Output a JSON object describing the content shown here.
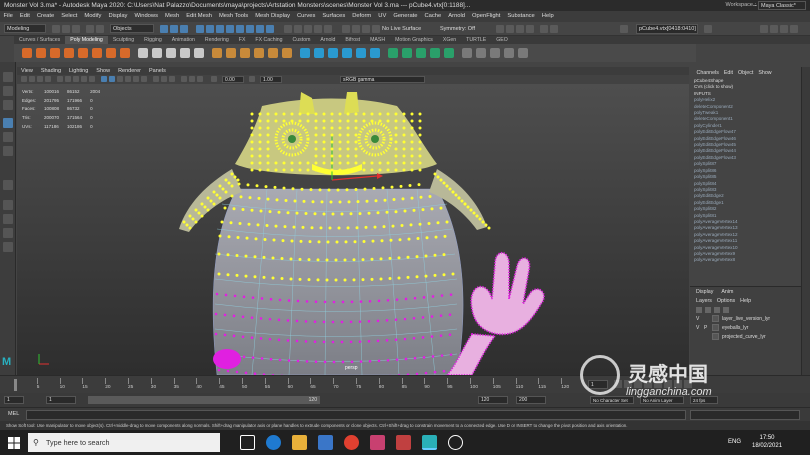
{
  "window": {
    "title": "Monster Vol 3.ma* - Autodesk Maya 2020: C:\\Users\\Nat Palazzo\\Documents\\maya\\projects\\Artstation Monsters\\scenes\\Monster Vol 3.ma   ---   pCube4.vtx[0:1188]...",
    "minimize": "–",
    "maximize": "□",
    "close": "✕"
  },
  "menubar": {
    "items": [
      "File",
      "Edit",
      "Create",
      "Select",
      "Modify",
      "Display",
      "Windows",
      "Mesh",
      "Edit Mesh",
      "Mesh Tools",
      "Mesh Display",
      "Curves",
      "Surfaces",
      "Deform",
      "UV",
      "Generate",
      "Cache",
      "Arnold",
      "OpenFlight",
      "Substance",
      "Help"
    ],
    "workspace_label": "Workspace :",
    "workspace_value": "Maya Classic*"
  },
  "statusline": {
    "mode": "Modeling",
    "objects": "Objects",
    "live_surface": "No Live Surface",
    "symmetry": "Symmetry: Off",
    "name_field": "pCube4.vtx[0418:0410]"
  },
  "shelf": {
    "tabs": [
      "Curves / Surfaces",
      "Poly Modeling",
      "Sculpting",
      "Rigging",
      "Animation",
      "Rendering",
      "FX",
      "FX Caching",
      "Custom",
      "Arnold",
      "Bifrost",
      "MASH",
      "Motion Graphics",
      "XGen",
      "TURTLE",
      "GEO"
    ],
    "active_tab": "Poly Modeling"
  },
  "viewport": {
    "menu": [
      "View",
      "Shading",
      "Lighting",
      "Show",
      "Renderer",
      "Panels"
    ],
    "field_a": "0.00",
    "field_b": "1.00",
    "color_space": "sRGB gamma",
    "camera_label": "persp",
    "hud": [
      {
        "label": "Verts:",
        "a": "100016",
        "b": "86152",
        "c": "2004"
      },
      {
        "label": "Edges:",
        "a": "201795",
        "b": "171966",
        "c": "0"
      },
      {
        "label": "Faces:",
        "a": "100808",
        "b": "86732",
        "c": "0"
      },
      {
        "label": "Tris:",
        "a": "200070",
        "b": "171564",
        "c": "0"
      },
      {
        "label": "UVs:",
        "a": "117186",
        "b": "102186",
        "c": "0"
      }
    ]
  },
  "channel_box": {
    "menu": [
      "Channels",
      "Edit",
      "Object",
      "Show"
    ],
    "object": "pCube4Shape",
    "cvs": "CVs (click to show)",
    "inputs_label": "INPUTS",
    "inputs": [
      "polyHelix2",
      "deleteComponent2",
      "polyTweak1",
      "deleteComponent1",
      "polyCylinder1",
      "polyEditEdgeFlow47",
      "polyEditEdgeFlow46",
      "polyEditEdgeFlow45",
      "polyEditEdgeFlow44",
      "polyEditEdgeFlow43",
      "polySplit87",
      "polySplit86",
      "polySplit85",
      "polySplit84",
      "polySplit83",
      "polyEditEdge2",
      "polyEditEdge1",
      "polySplit82",
      "polySplit81",
      "polyAverageVertex14",
      "polyAverageVertex13",
      "polyAverageVertex12",
      "polyAverageVertex11",
      "polyAverageVertex10",
      "polyAverageVertex9",
      "polyAverageVertex8"
    ]
  },
  "layer_editor": {
    "tabs": [
      "Display",
      "Anim"
    ],
    "menu": [
      "Layers",
      "Options",
      "Help"
    ],
    "layers": [
      {
        "v": "V",
        "p": "",
        "name": "layer_live_version_lyr"
      },
      {
        "v": "V",
        "p": "P",
        "name": "eyeballs_lyr"
      },
      {
        "v": "",
        "p": "",
        "name": "projected_curve_lyr"
      }
    ]
  },
  "timeslider": {
    "ticks": [
      "5",
      "10",
      "15",
      "20",
      "25",
      "30",
      "35",
      "40",
      "45",
      "50",
      "55",
      "60",
      "65",
      "70",
      "75",
      "80",
      "85",
      "90",
      "95",
      "100",
      "105",
      "110",
      "115",
      "120"
    ],
    "current_frame": "1"
  },
  "rangeslider": {
    "start": "1",
    "start2": "1",
    "range_label": "120",
    "end": "120",
    "end2": "200",
    "char_set": "No Character Set",
    "anim_layer": "No Anim Layer",
    "fps": "24 fps"
  },
  "cmdline": {
    "label": "MEL"
  },
  "helpline": "Show Soft tool: Use manipulator to move object(s). Ctrl+middle-drag to move components along normals. Shift+drag manipulator axis or plane handles to extrude components or clone objects. Ctrl+Shift+drag to constrain movement to a connected edge. Use D or INSERT to change the pivot position and axis orientation.",
  "taskbar": {
    "search_placeholder": "Type here to search",
    "lang": "ENG",
    "time": "17:50",
    "date": "18/02/2021"
  },
  "watermark": {
    "brand": "灵感中国",
    "url": "lingganchina.com"
  },
  "colors": {
    "yellow": "#ffff33",
    "magenta": "#e020e0",
    "wire": "#7ad0e0",
    "accent": "#4a7fb0"
  }
}
